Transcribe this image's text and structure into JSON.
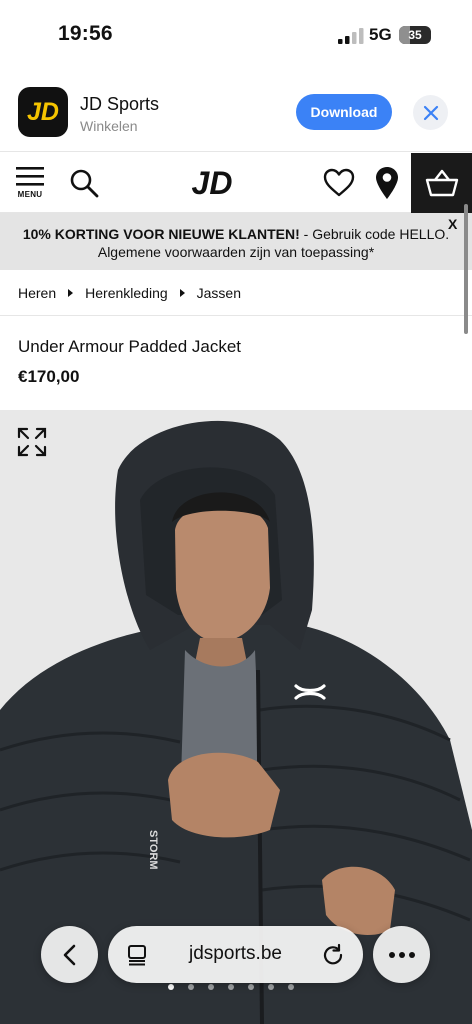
{
  "status_bar": {
    "time": "19:56",
    "network": "5G",
    "battery": "35",
    "battery_level": 0.35
  },
  "app_banner": {
    "app_name": "JD Sports",
    "app_category": "Winkelen",
    "download_label": "Download",
    "logo_text": "JD",
    "brand_yellow": "#f5c400",
    "button_color": "#3b82f6"
  },
  "nav": {
    "menu_label": "MENU",
    "logo_text": "JD"
  },
  "promo": {
    "bold_text": "10% KORTING VOOR NIEUWE KLANTEN!",
    "text": " - Gebruik code HELLO. Algemene voorwaarden zijn van toepassing*",
    "close_label": "X"
  },
  "breadcrumb": [
    "Heren",
    "Herenkleding",
    "Jassen"
  ],
  "product": {
    "title": "Under Armour Padded Jacket",
    "price": "€170,00",
    "sleeve_text": "STORM"
  },
  "carousel": {
    "count": 7,
    "active_index": 0
  },
  "browser": {
    "url": "jdsports.be"
  }
}
